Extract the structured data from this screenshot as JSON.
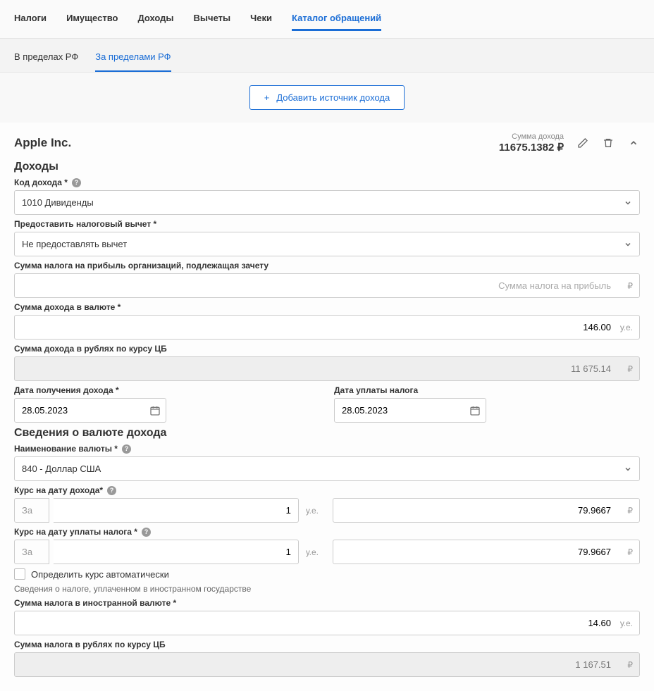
{
  "topnav": {
    "items": [
      "Налоги",
      "Имущество",
      "Доходы",
      "Вычеты",
      "Чеки",
      "Каталог обращений"
    ],
    "active_index": 5
  },
  "subtabs": {
    "items": [
      "В пределах РФ",
      "За пределами РФ"
    ],
    "active_index": 1
  },
  "add_button": "Добавить источник дохода",
  "card": {
    "company": "Apple Inc.",
    "summary_label": "Сумма дохода",
    "summary_value": "11675.1382 ₽",
    "section_income": "Доходы",
    "income_code_label": "Код дохода *",
    "income_code_value": "1010 Дивиденды",
    "deduction_label": "Предоставить налоговый вычет *",
    "deduction_value": "Не предоставлять вычет",
    "tax_credit_label": "Сумма налога на прибыль организаций, подлежащая зачету",
    "tax_credit_placeholder": "Сумма налога на прибыль",
    "income_fx_label": "Сумма дохода в валюте *",
    "income_fx_value": "146.00",
    "income_rub_label": "Сумма дохода в рублях по курсу ЦБ",
    "income_rub_value": "11 675.14",
    "date_received_label": "Дата получения дохода *",
    "date_received_value": "28.05.2023",
    "date_tax_label": "Дата уплаты налога",
    "date_tax_value": "28.05.2023",
    "section_currency": "Сведения о валюте дохода",
    "currency_name_label": "Наименование валюты *",
    "currency_name_value": "840 - Доллар США",
    "rate_income_label": "Курс на дату дохода*",
    "rate_tax_label": "Курс на дату уплаты налога *",
    "rate_za": "За",
    "rate_per": "1",
    "rate_value": "79.9667",
    "auto_rate_label": "Определить курс автоматически",
    "foreign_tax_section": "Сведения о налоге, уплаченном в иностранном государстве",
    "foreign_tax_fx_label": "Сумма налога в иностранной валюте *",
    "foreign_tax_fx_value": "14.60",
    "foreign_tax_rub_label": "Сумма налога в рублях по курсу ЦБ",
    "foreign_tax_rub_value": "1 167.51",
    "unit_ue": "у.е.",
    "unit_rub": "₽"
  }
}
